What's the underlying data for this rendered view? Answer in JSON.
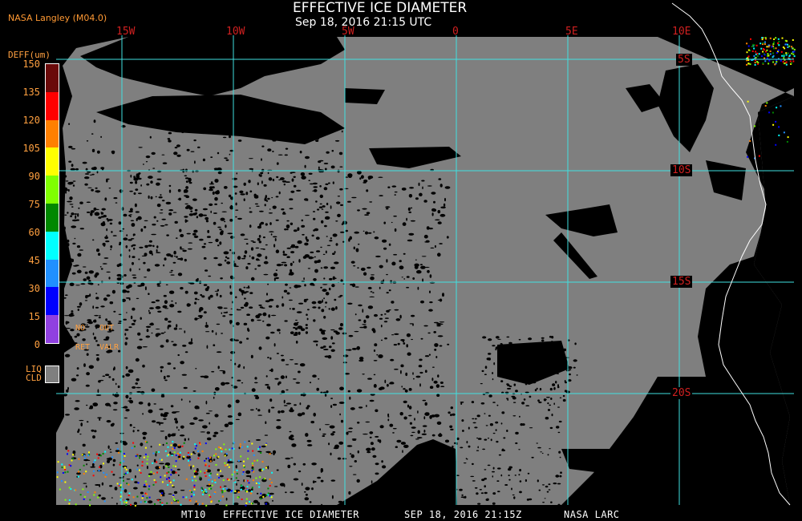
{
  "header": {
    "title": "EFFECTIVE ICE DIAMETER",
    "subtitle": "Sep 18, 2016 21:15 UTC",
    "credit": "NASA Langley (M04.0)"
  },
  "map": {
    "longitude_labels": [
      "15W",
      "10W",
      "5W",
      "0",
      "5E",
      "10E"
    ],
    "latitude_labels": [
      "5S",
      "10S",
      "15S",
      "20S"
    ],
    "colors": {
      "background": "#000000",
      "clear": "#000000",
      "liquid_cloud": "#7f7f7f",
      "gridline": "#40e0e0",
      "coastline": "#ffffff",
      "grid_label": "#d02020"
    }
  },
  "legend": {
    "unit_label": "DEFF(um)",
    "ticks": [
      "150",
      "135",
      "120",
      "105",
      "90",
      "75",
      "60",
      "45",
      "30",
      "15",
      "0"
    ],
    "colors": [
      "#6a0a0a",
      "#ff0000",
      "#ff8000",
      "#ffff00",
      "#80ff00",
      "#008800",
      "#00ffff",
      "#2090ff",
      "#0000ff",
      "#9040e0"
    ],
    "flags": {
      "no": "NO",
      "out": "OUT",
      "ret": "RET",
      "valr": "VALR"
    },
    "liquid_cloud_label": [
      "LIQ",
      "CLD"
    ]
  },
  "footer": {
    "product": "MT10",
    "title": "EFFECTIVE ICE DIAMETER",
    "datetime": "SEP 18, 2016 21:15Z",
    "agency": "NASA LARC"
  }
}
